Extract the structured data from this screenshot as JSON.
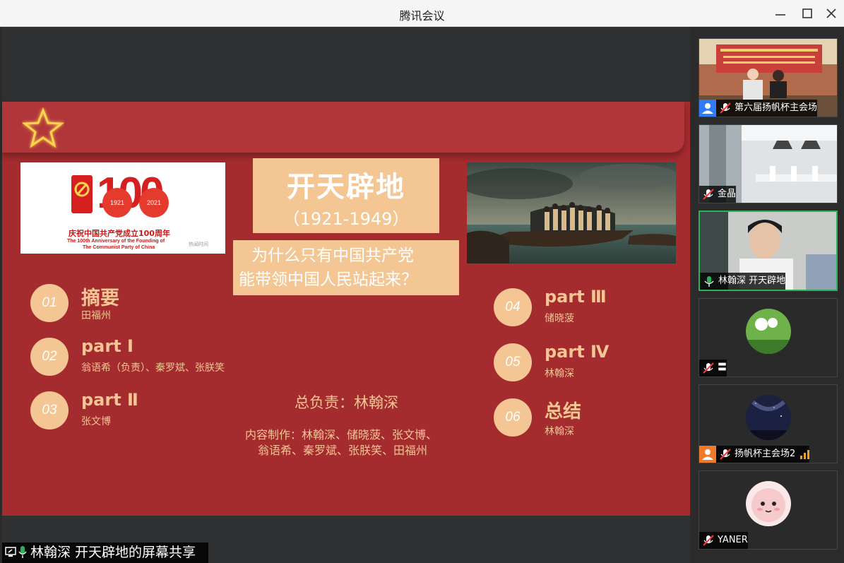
{
  "window": {
    "title": "腾讯会议"
  },
  "slide": {
    "title": "开天辟地",
    "years": "（1921-1949）",
    "question_line1": "为什么只有中国共产党",
    "question_line2": "能带领中国人民站起来？",
    "logo": {
      "number": "100",
      "year_start": "1921",
      "year_end": "2021",
      "cn": "庆祝中国共产党成立100周年",
      "en1": "The 100th Anniversary of the Founding of",
      "en2": "The Communist Party of China",
      "mark": "热闻时间"
    },
    "items": [
      {
        "num": "01",
        "head": "摘要",
        "sub": "田福州"
      },
      {
        "num": "02",
        "head": "part Ⅰ",
        "sub": "翁语希（负责）、秦罗斌、张朕笑"
      },
      {
        "num": "03",
        "head": "part Ⅱ",
        "sub": "张文博"
      },
      {
        "num": "04",
        "head": "part Ⅲ",
        "sub": "储晓菠"
      },
      {
        "num": "05",
        "head": "part Ⅳ",
        "sub": "林翰深"
      },
      {
        "num": "06",
        "head": "总结",
        "sub": "林翰深"
      }
    ],
    "lead": "总负责：林翰深",
    "credits_line1": "内容制作：林翰深、储晓菠、张文博、",
    "credits_line2": "翁语希、秦罗斌、张朕笑、田福州"
  },
  "share_label": "林翰深 开天辟地的屏幕共享",
  "participants": [
    {
      "name": "第六届扬帆杯主会场"
    },
    {
      "name": "金晶"
    },
    {
      "name": "林翰深 开天辟地"
    },
    {
      "name": "〓"
    },
    {
      "name": "扬帆杯主会场2"
    },
    {
      "name": "YANER"
    }
  ],
  "colors": {
    "slide_red": "#a42b2e",
    "accent_peach": "#f3c694",
    "active_green": "#2eb05b"
  }
}
